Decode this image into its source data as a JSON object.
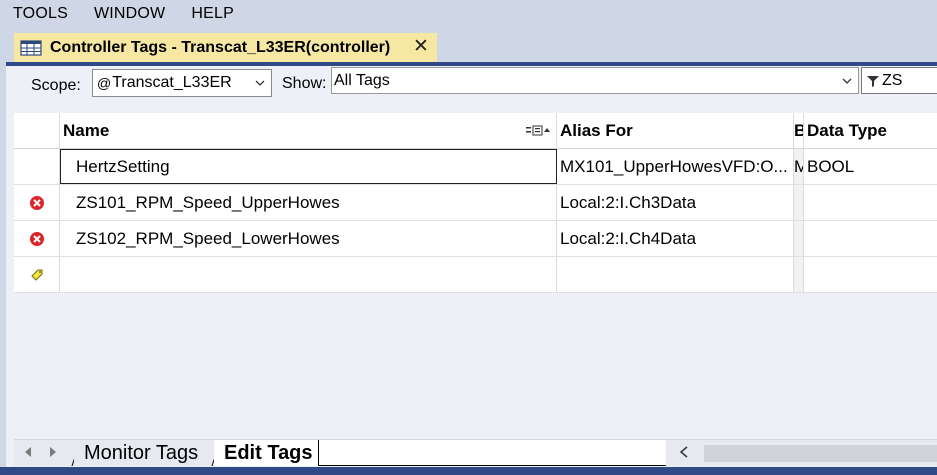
{
  "menu": {
    "items": [
      "TOOLS",
      "WINDOW",
      "HELP"
    ]
  },
  "doc_tab": {
    "title": "Controller Tags - Transcat_L33ER(controller)",
    "close_glyph": "✕"
  },
  "filter": {
    "scope_label": "Scope:",
    "scope_value": "Transcat_L33ER",
    "show_label": "Show:",
    "show_value": "All Tags",
    "filter_text": "ZS"
  },
  "grid": {
    "columns": [
      "",
      "Name",
      "Alias For",
      "B",
      "Data Type"
    ],
    "rows": [
      {
        "status": "none",
        "name": "HertzSetting",
        "alias_for": "MX101_UpperHowesVFD:O...",
        "base": "M",
        "data_type": "BOOL"
      },
      {
        "status": "error",
        "name": "ZS101_RPM_Speed_UpperHowes",
        "alias_for": "Local:2:I.Ch3Data",
        "base": "",
        "data_type": ""
      },
      {
        "status": "error",
        "name": "ZS102_RPM_Speed_LowerHowes",
        "alias_for": "Local:2:I.Ch4Data",
        "base": "",
        "data_type": ""
      },
      {
        "status": "new",
        "name": "",
        "alias_for": "",
        "base": "",
        "data_type": ""
      }
    ]
  },
  "sheet_tabs": {
    "monitor": "Monitor Tags",
    "edit": "Edit Tags"
  },
  "colors": {
    "accent": "#2f4a86",
    "tab_highlight": "#f6e7a3",
    "error_red": "#d9262b"
  }
}
